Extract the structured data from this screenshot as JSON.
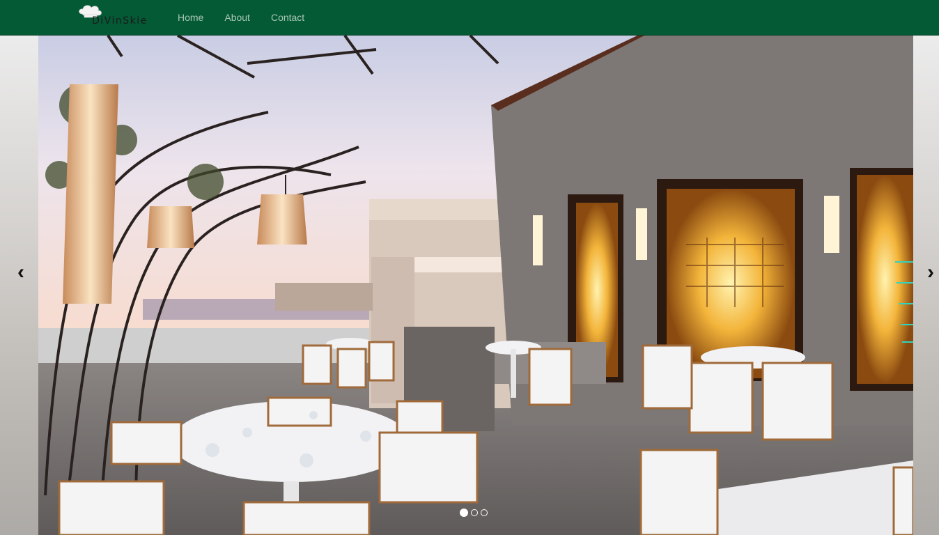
{
  "navbar": {
    "brand": "DiVinSkie",
    "links": [
      {
        "label": "Home"
      },
      {
        "label": "About"
      },
      {
        "label": "Contact"
      }
    ]
  },
  "carousel": {
    "prev_icon": "chevron-left-icon",
    "next_icon": "chevron-right-icon",
    "prev_glyph": "‹",
    "next_glyph": "›",
    "slide_count": 3,
    "active_index": 0
  },
  "colors": {
    "navbar_bg": "#045a34",
    "nav_link": "#a8c7b6"
  }
}
